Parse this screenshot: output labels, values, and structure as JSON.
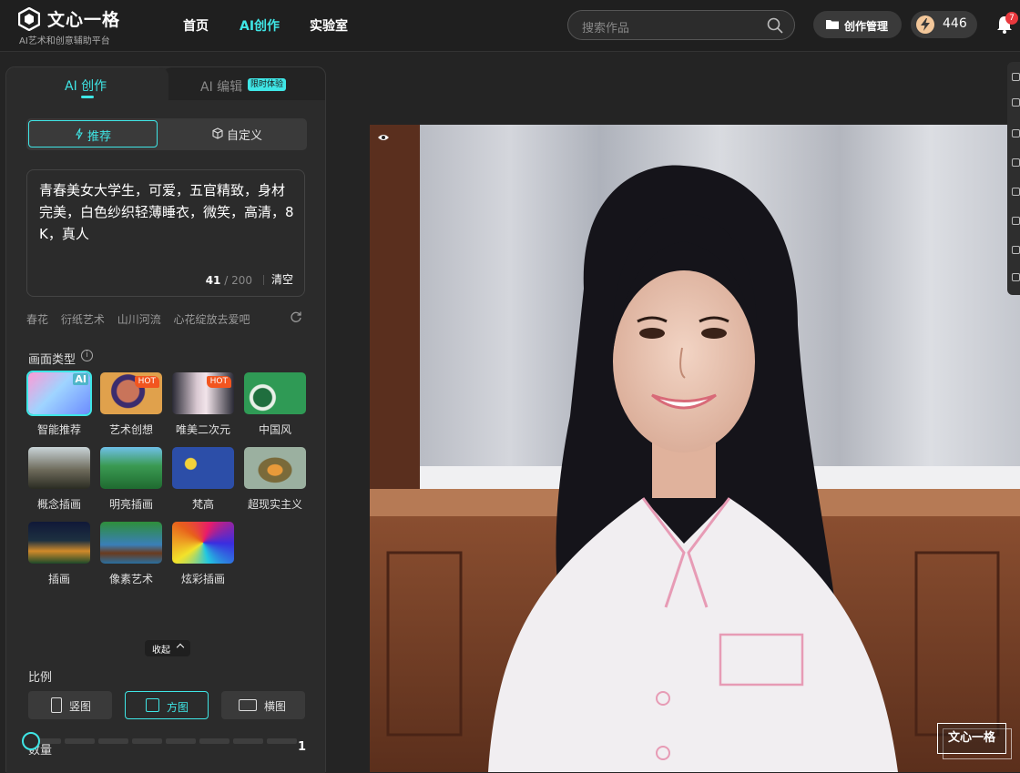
{
  "brand": {
    "name": "文心一格",
    "tagline": "AI艺术和创意辅助平台"
  },
  "nav": {
    "home": "首页",
    "ai_create": "AI创作",
    "lab": "实验室"
  },
  "search": {
    "placeholder": "搜索作品"
  },
  "header": {
    "manage_label": "创作管理",
    "points": "446",
    "notification_count": "7"
  },
  "tabs": {
    "create": "AI 创作",
    "edit": "AI 编辑",
    "edit_badge": "限时体验"
  },
  "mode": {
    "recommend": "推荐",
    "custom": "自定义"
  },
  "prompt": {
    "text": "青春美女大学生，可爱，五官精致，身材完美，白色纱织轻薄睡衣，微笑，高清，8K，真人",
    "count": "41",
    "max": "200",
    "clear_label": "清空"
  },
  "suggestions": [
    "春花",
    "衍纸艺术",
    "山川河流",
    "心花绽放去爱吧"
  ],
  "style_section": {
    "title": "画面类型",
    "collapse_label": "收起"
  },
  "styles": [
    {
      "name": "智能推荐",
      "badge": "AI"
    },
    {
      "name": "艺术创想",
      "badge": "HOT"
    },
    {
      "name": "唯美二次元",
      "badge": "HOT"
    },
    {
      "name": "中国风",
      "badge": ""
    },
    {
      "name": "概念插画",
      "badge": ""
    },
    {
      "name": "明亮插画",
      "badge": ""
    },
    {
      "name": "梵高",
      "badge": ""
    },
    {
      "name": "超现实主义",
      "badge": ""
    },
    {
      "name": "插画",
      "badge": ""
    },
    {
      "name": "像素艺术",
      "badge": ""
    },
    {
      "name": "炫彩插画",
      "badge": ""
    }
  ],
  "ratio": {
    "title": "比例",
    "portrait": "竖图",
    "square": "方图",
    "landscape": "横图",
    "selected": "方图"
  },
  "quantity": {
    "title": "数量",
    "value": "1"
  },
  "canvas": {
    "watermark": "文心一格"
  },
  "colors": {
    "accent": "#3fe6e6",
    "background": "#242424",
    "panel": "#2b2b2b",
    "hot": "#f2551f"
  }
}
